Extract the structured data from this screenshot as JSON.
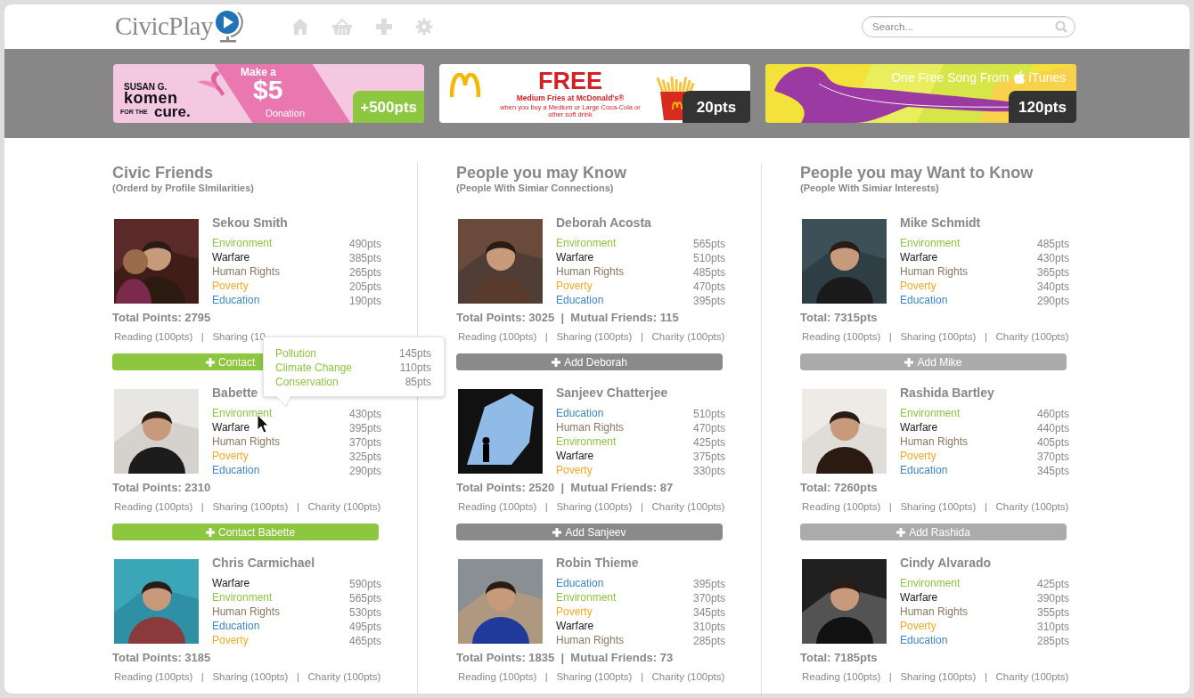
{
  "header": {
    "logo": "CivicPlay",
    "search": {
      "placeholder": "Search..."
    }
  },
  "ads": [
    {
      "kind": "donation",
      "logo": [
        "SUSAN G.",
        "komen",
        "FOR THE",
        "cure."
      ],
      "offer": [
        "Make a",
        "$5",
        "Donation"
      ],
      "points": "+500pts"
    },
    {
      "kind": "fries",
      "headline": "FREE",
      "subline": "Medium Fries at McDonald's®",
      "fine_print": "when you buy a Medium or Large Coca-Cola or other soft drink",
      "points": "20pts"
    },
    {
      "kind": "song",
      "headline": "One Free Song From",
      "brand": "iTunes",
      "points": "120pts"
    }
  ],
  "columns": [
    {
      "kind": "friends",
      "title": "Civic Friends",
      "subtitle": "(Orderd by Profile SImilarities)",
      "people": [
        {
          "name": "Sekou Smith",
          "interests": [
            {
              "label": "Environment",
              "points": "490pts",
              "color": "#8dc63f"
            },
            {
              "label": "Warfare",
              "points": "385pts",
              "color": "#1a1a1a"
            },
            {
              "label": "Human Rights",
              "points": "265pts",
              "color": "#8c7660"
            },
            {
              "label": "Poverty",
              "points": "205pts",
              "color": "#f7a823"
            },
            {
              "label": "Education",
              "points": "190pts",
              "color": "#3b87c9"
            }
          ],
          "total": "Total Points: 2795",
          "activities": "Reading (100pts)   |   Sharing (10",
          "button": "Contact"
        },
        {
          "name": "Babette",
          "interests": [
            {
              "label": "Environment",
              "points": "430pts",
              "color": "#8dc63f"
            },
            {
              "label": "Warfare",
              "points": "395pts",
              "color": "#1a1a1a"
            },
            {
              "label": "Human Rights",
              "points": "370pts",
              "color": "#8c7660"
            },
            {
              "label": "Poverty",
              "points": "325pts",
              "color": "#f7a823"
            },
            {
              "label": "Education",
              "points": "290pts",
              "color": "#3b87c9"
            }
          ],
          "total": "Total Points: 2310",
          "activities": "Reading (100pts)   |   Sharing (100pts)   |   Charity (100pts)",
          "button": "Contact Babette"
        },
        {
          "name": "Chris Carmichael",
          "interests": [
            {
              "label": "Warfare",
              "points": "590pts",
              "color": "#1a1a1a"
            },
            {
              "label": "Environment",
              "points": "565pts",
              "color": "#8dc63f"
            },
            {
              "label": "Human Rights",
              "points": "530pts",
              "color": "#8c7660"
            },
            {
              "label": "Education",
              "points": "495pts",
              "color": "#3b87c9"
            },
            {
              "label": "Poverty",
              "points": "465pts",
              "color": "#f7a823"
            }
          ],
          "total": "Total Points: 3185",
          "activities": "Reading (100pts)   |   Sharing (100pts)   |   Charity (100pts)"
        }
      ]
    },
    {
      "kind": "known",
      "title": "People you may Know",
      "subtitle": "(People With Simiar Connections)",
      "people": [
        {
          "name": "Deborah Acosta",
          "interests": [
            {
              "label": "Environment",
              "points": "565pts",
              "color": "#8dc63f"
            },
            {
              "label": "Warfare",
              "points": "510pts",
              "color": "#1a1a1a"
            },
            {
              "label": "Human Rights",
              "points": "485pts",
              "color": "#8c7660"
            },
            {
              "label": "Poverty",
              "points": "470pts",
              "color": "#f7a823"
            },
            {
              "label": "Education",
              "points": "395pts",
              "color": "#3b87c9"
            }
          ],
          "total": "Total Points: 3025  |  Mutual Friends: 115",
          "activities": "Reading (100pts)   |   Sharing (100pts)   |   Charity (100pts)",
          "button": "Add Deborah"
        },
        {
          "name": "Sanjeev Chatterjee",
          "interests": [
            {
              "label": "Education",
              "points": "510pts",
              "color": "#3b87c9"
            },
            {
              "label": "Human Rights",
              "points": "470pts",
              "color": "#8c7660"
            },
            {
              "label": "Environment",
              "points": "425pts",
              "color": "#8dc63f"
            },
            {
              "label": "Warfare",
              "points": "375pts",
              "color": "#1a1a1a"
            },
            {
              "label": "Poverty",
              "points": "330pts",
              "color": "#f7a823"
            }
          ],
          "total": "Total Points: 2520  |  Mutual Friends: 87",
          "activities": "Reading (100pts)   |   Sharing (100pts)   |   Charity (100pts)",
          "button": "Add Sanjeev"
        },
        {
          "name": "Robin Thieme",
          "interests": [
            {
              "label": "Education",
              "points": "395pts",
              "color": "#3b87c9"
            },
            {
              "label": "Environment",
              "points": "370pts",
              "color": "#8dc63f"
            },
            {
              "label": "Poverty",
              "points": "345pts",
              "color": "#f7a823"
            },
            {
              "label": "Warfare",
              "points": "310pts",
              "color": "#1a1a1a"
            },
            {
              "label": "Human Rights",
              "points": "285pts",
              "color": "#8c7660"
            }
          ],
          "total": "Total Points: 1835  |  Mutual Friends: 73",
          "activities": "Reading (100pts)   |   Sharing (100pts)   |   Charity (100pts)"
        }
      ]
    },
    {
      "kind": "suggested",
      "title": "People you may Want to Know",
      "subtitle": "(People With Simiar Interests)",
      "people": [
        {
          "name": "Mike Schmidt",
          "interests": [
            {
              "label": "Environment",
              "points": "485pts",
              "color": "#8dc63f"
            },
            {
              "label": "Warfare",
              "points": "430pts",
              "color": "#1a1a1a"
            },
            {
              "label": "Human Rights",
              "points": "365pts",
              "color": "#8c7660"
            },
            {
              "label": "Poverty",
              "points": "340pts",
              "color": "#f7a823"
            },
            {
              "label": "Education",
              "points": "290pts",
              "color": "#3b87c9"
            }
          ],
          "total": "Total: 7315pts",
          "activities": "Reading (100pts)   |   Sharing (100pts)   |   Charity (100pts)",
          "button": "Add Mike"
        },
        {
          "name": "Rashida Bartley",
          "interests": [
            {
              "label": "Environment",
              "points": "460pts",
              "color": "#8dc63f"
            },
            {
              "label": "Warfare",
              "points": "440pts",
              "color": "#1a1a1a"
            },
            {
              "label": "Human Rights",
              "points": "405pts",
              "color": "#8c7660"
            },
            {
              "label": "Poverty",
              "points": "370pts",
              "color": "#f7a823"
            },
            {
              "label": "Education",
              "points": "345pts",
              "color": "#3b87c9"
            }
          ],
          "total": "Total: 7260pts",
          "activities": "Reading (100pts)   |   Sharing (100pts)   |   Charity (100pts)",
          "button": "Add Rashida"
        },
        {
          "name": "Cindy Alvarado",
          "interests": [
            {
              "label": "Environment",
              "points": "425pts",
              "color": "#8dc63f"
            },
            {
              "label": "Warfare",
              "points": "390pts",
              "color": "#1a1a1a"
            },
            {
              "label": "Human Rights",
              "points": "355pts",
              "color": "#8c7660"
            },
            {
              "label": "Poverty",
              "points": "310pts",
              "color": "#f7a823"
            },
            {
              "label": "Education",
              "points": "285pts",
              "color": "#3b87c9"
            }
          ],
          "total": "Total: 7185pts",
          "activities": "Reading (100pts)   |   Sharing (100pts)   |   Charity (100pts)"
        }
      ]
    }
  ],
  "tooltip": {
    "items": [
      {
        "label": "Pollution",
        "points": "145pts"
      },
      {
        "label": "Climate Change",
        "points": "110pts"
      },
      {
        "label": "Conservation",
        "points": "85pts"
      }
    ]
  }
}
